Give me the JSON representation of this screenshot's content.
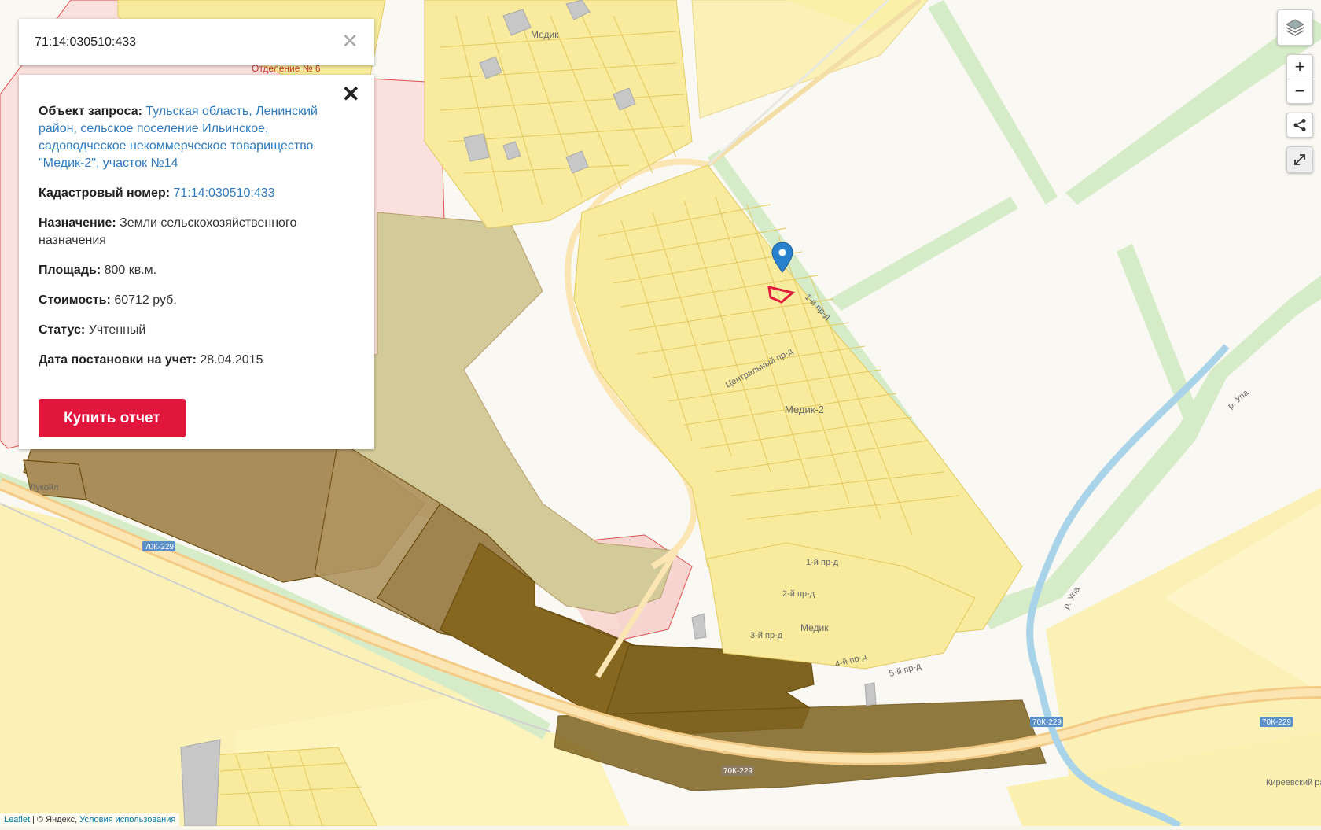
{
  "search": {
    "value": "71:14:030510:433"
  },
  "info": {
    "object_label": "Объект запроса:",
    "object_value": "Тульская область, Ленинский район, сельское поселение Ильинское, садоводческое некоммерческое товарищество \"Медик-2\", участок №14",
    "cadastral_label": "Кадастровый номер:",
    "cadastral_value": "71:14:030510:433",
    "purpose_label": "Назначение:",
    "purpose_value": "Земли сельскохозяйственного назначения",
    "area_label": "Площадь:",
    "area_value": "800 кв.м.",
    "cost_label": "Стоимость:",
    "cost_value": "60712 руб.",
    "status_label": "Статус:",
    "status_value": "Учтенный",
    "date_label": "Дата постановки на учет:",
    "date_value": "28.04.2015",
    "buy_button": "Купить отчет"
  },
  "controls": {
    "zoom_in": "+",
    "zoom_out": "−"
  },
  "attribution": {
    "leaflet": "Leaflet",
    "yandex": " | © Яндекс, ",
    "terms": "Условия использования"
  },
  "map_labels": {
    "medik": "Медик",
    "medik2": "Медик-2",
    "lukoil": "Лукойл",
    "otdelenie": "Отделение № 6",
    "kireevsky": "Киреевский район",
    "road_70k229": "70К-229",
    "river": "р. Упа",
    "street_1": "1-й пр-д",
    "street_2": "2-й пр-д",
    "street_3": "3-й пр-д",
    "street_4": "4-й пр-д",
    "street_5": "5-й пр-д",
    "central": "Центральный пр-д"
  },
  "colors": {
    "accent": "#e0163d",
    "link": "#2f7ab8",
    "parcel_fill": "#f8eb9e",
    "parcel_stroke": "#e2c95f",
    "dark_parcel": "#7e6420",
    "mid_parcel": "#a88e55",
    "light_olive": "#cdc596",
    "green": "#d3ebc5",
    "river": "#a9d3e8",
    "marker": "#2a81cb"
  }
}
